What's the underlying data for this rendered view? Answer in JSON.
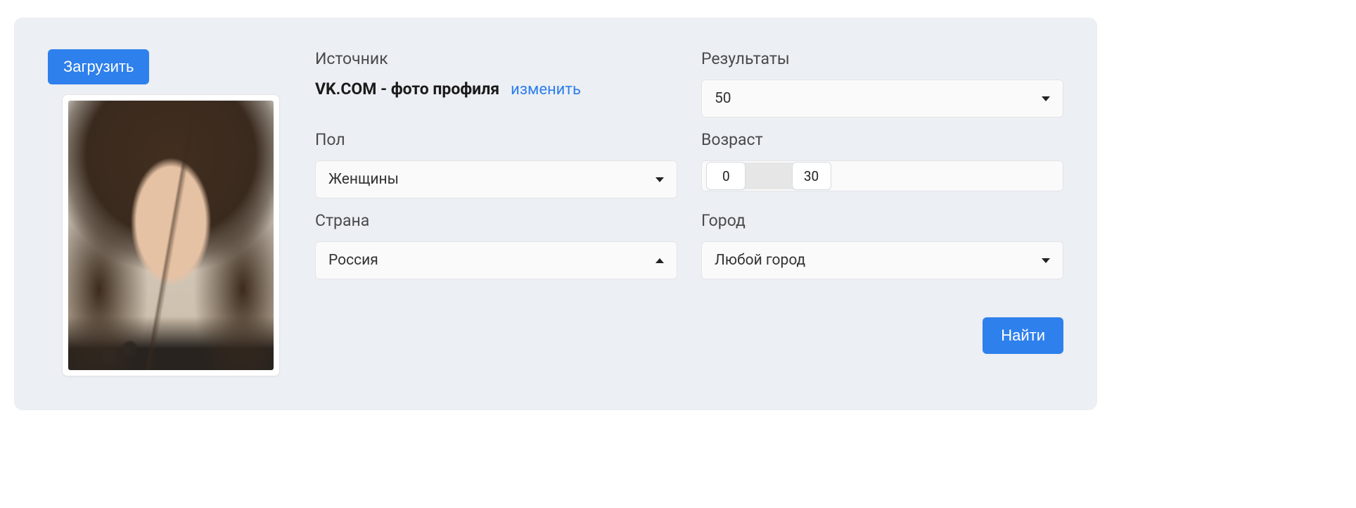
{
  "upload_button": "Загрузить",
  "search_button": "Найти",
  "source": {
    "label": "Источник",
    "value": "VK.COM - фото профиля",
    "change_link": "изменить"
  },
  "results": {
    "label": "Результаты",
    "value": "50"
  },
  "gender": {
    "label": "Пол",
    "value": "Женщины"
  },
  "age": {
    "label": "Возраст",
    "min": "0",
    "max": "30",
    "min_pct": 6,
    "max_pct": 30
  },
  "country": {
    "label": "Страна",
    "value": "Россия",
    "open": true
  },
  "city": {
    "label": "Город",
    "value": "Любой город"
  }
}
